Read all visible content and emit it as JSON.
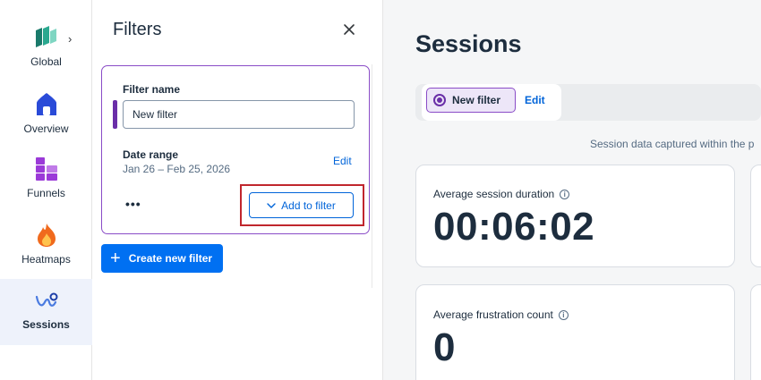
{
  "nav": {
    "items": [
      {
        "label": "Global"
      },
      {
        "label": "Overview"
      },
      {
        "label": "Funnels"
      },
      {
        "label": "Heatmaps"
      },
      {
        "label": "Sessions"
      }
    ]
  },
  "filters_panel": {
    "title": "Filters",
    "card": {
      "name_label": "Filter name",
      "name_value": "New filter",
      "date_label": "Date range",
      "date_value": "Jan 26 – Feb 25, 2026",
      "edit_label": "Edit",
      "more_label": "•••",
      "add_label": "Add to filter"
    },
    "create_label": "Create new filter"
  },
  "main": {
    "title": "Sessions",
    "chip_label": "New filter",
    "chip_edit": "Edit",
    "captured_text": "Session data captured within the p",
    "cards": [
      {
        "label": "Average session duration",
        "value": "00:06:02"
      },
      {
        "label": "Average frustration count",
        "value": "0"
      }
    ]
  },
  "colors": {
    "accent_purple": "#8a4cc7",
    "link_blue": "#0064d9",
    "primary_button": "#0070f2",
    "highlight_red": "#c0262d"
  }
}
